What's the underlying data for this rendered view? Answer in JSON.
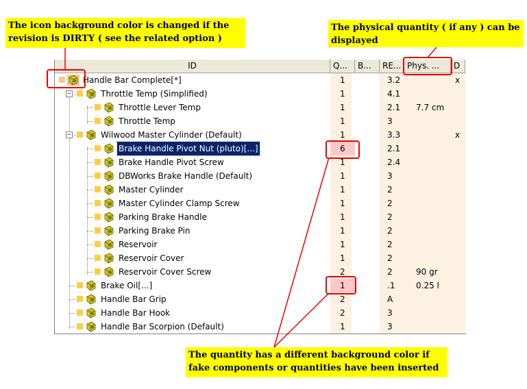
{
  "notes": {
    "icon_bg": "The icon background color is changed if the revision is DIRTY ( see the related option )",
    "icon_bg_line1": "The icon background color is changed if the",
    "icon_bg_line2": "revision is DIRTY ( see the related option )",
    "phys_line1": "The physical quantity ( if any ) can be",
    "phys_line2": "displayed",
    "qty_line1": "The quantity has a different background color if",
    "qty_line2": "fake components or quantities have been inserted"
  },
  "columns": {
    "id": "ID",
    "qty": "Q...",
    "b": "B...",
    "rev": "RE...",
    "phys": "Phys. ...",
    "d": "D"
  },
  "rows": [
    {
      "name": "Handle Bar Complete[*]",
      "qty": "1",
      "rev": "3.2",
      "phys": "",
      "d": "x"
    },
    {
      "name": "Throttle Temp (Simplified)",
      "qty": "1",
      "rev": "4.1",
      "phys": "",
      "d": ""
    },
    {
      "name": "Throttle Lever Temp",
      "qty": "1",
      "rev": "2.1",
      "phys": "7.7 cm",
      "d": ""
    },
    {
      "name": "Throttle Temp",
      "qty": "1",
      "rev": "3",
      "phys": "",
      "d": ""
    },
    {
      "name": "Wilwood Master Cylinder (Default)",
      "qty": "1",
      "rev": "3.3",
      "phys": "",
      "d": "x"
    },
    {
      "name": "Brake Handle Pivot Nut (pluto)[...]",
      "qty": "6",
      "rev": "2.1",
      "phys": "",
      "d": ""
    },
    {
      "name": "Brake Handle Pivot Screw",
      "qty": "1",
      "rev": "2.4",
      "phys": "",
      "d": ""
    },
    {
      "name": "DBWorks Brake Handle (Default)",
      "qty": "1",
      "rev": "3",
      "phys": "",
      "d": ""
    },
    {
      "name": "Master Cylinder",
      "qty": "1",
      "rev": "2",
      "phys": "",
      "d": ""
    },
    {
      "name": "Master Cylinder Clamp Screw",
      "qty": "1",
      "rev": "2",
      "phys": "",
      "d": ""
    },
    {
      "name": "Parking Brake Handle",
      "qty": "1",
      "rev": "2",
      "phys": "",
      "d": ""
    },
    {
      "name": "Parking Brake Pin",
      "qty": "1",
      "rev": "2",
      "phys": "",
      "d": ""
    },
    {
      "name": "Reservoir",
      "qty": "1",
      "rev": "2",
      "phys": "",
      "d": ""
    },
    {
      "name": "Reservoir Cover",
      "qty": "1",
      "rev": "2",
      "phys": "",
      "d": ""
    },
    {
      "name": "Reservoir Cover Screw",
      "qty": "2",
      "rev": "2",
      "phys": "90 gr",
      "d": ""
    },
    {
      "name": "Brake Oil[...]",
      "qty": "1",
      "rev": ".1",
      "phys": "0.25 l",
      "d": ""
    },
    {
      "name": "Handle Bar Grip",
      "qty": "2",
      "rev": "A",
      "phys": "",
      "d": ""
    },
    {
      "name": "Handle Bar Hook",
      "qty": "2",
      "rev": "3",
      "phys": "",
      "d": ""
    },
    {
      "name": "Handle Bar Scorpion (Default)",
      "qty": "1",
      "rev": "3",
      "phys": "",
      "d": ""
    }
  ],
  "colors": {
    "note_bg": "#ffff00",
    "column_shade": "#fdf1e2",
    "fake_qty_bg": "#ffc8c8",
    "dirty_icon_bg": "#f4c890",
    "highlight": "#ee0000",
    "selection": "#0a246a"
  },
  "icons": {
    "part": "assembly-part-icon",
    "folder": "component-square-icon"
  }
}
